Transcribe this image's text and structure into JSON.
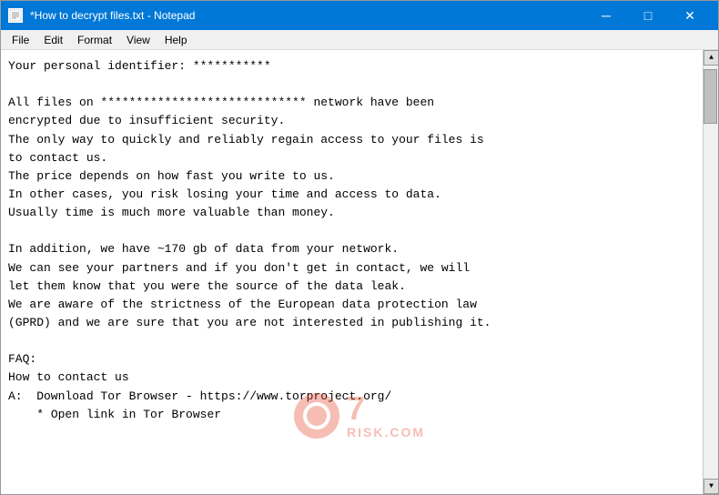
{
  "window": {
    "title": "*How to decrypt files.txt - Notepad",
    "icon_label": "notepad-icon"
  },
  "titlebar": {
    "minimize_label": "─",
    "maximize_label": "□",
    "close_label": "✕"
  },
  "menubar": {
    "items": [
      "File",
      "Edit",
      "Format",
      "View",
      "Help"
    ]
  },
  "content": {
    "text": "Your personal identifier: ***********\n\nAll files on ***************************** network have been\nencrypted due to insufficient security.\nThe only way to quickly and reliably regain access to your files is\nto contact us.\nThe price depends on how fast you write to us.\nIn other cases, you risk losing your time and access to data.\nUsually time is much more valuable than money.\n\nIn addition, we have ~170 gb of data from your network.\nWe can see your partners and if you don't get in contact, we will\nlet them know that you were the source of the data leak.\nWe are aware of the strictness of the European data protection law\n(GPRD) and we are sure that you are not interested in publishing it.\n\nFAQ:\nHow to contact us\nA:  Download Tor Browser - https://www.torproject.org/\n    * Open link in Tor Browser"
  },
  "watermark": {
    "number": "7",
    "label": "RISK.COM"
  }
}
